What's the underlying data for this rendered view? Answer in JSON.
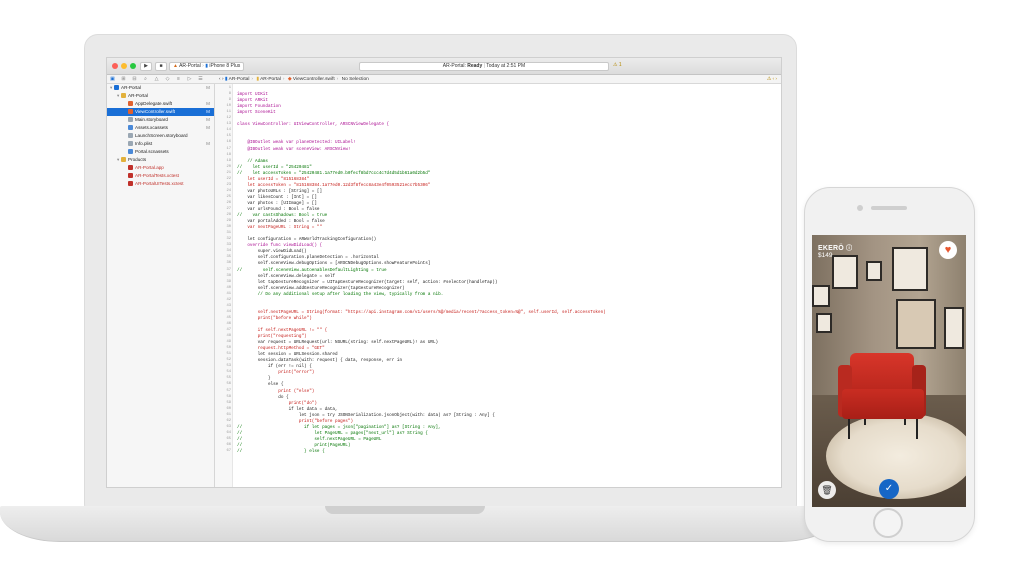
{
  "toolbar": {
    "scheme": "AR-Portal",
    "device": "iPhone 8 Plus",
    "status_app": "AR-Portal:",
    "status_state": "Ready",
    "status_time": "Today at 2:51 PM",
    "warning_count": "1"
  },
  "jumpbar": {
    "project": "AR-Portal",
    "folder": "AR-Portal",
    "file": "ViewController.swift",
    "selection": "No Selection"
  },
  "navigator": {
    "items": [
      {
        "label": "AR-Portal",
        "marker": "M",
        "indent": 0
      },
      {
        "label": "AR-Portal",
        "marker": "",
        "indent": 1
      },
      {
        "label": "AppDelegate.swift",
        "marker": "M",
        "indent": 2
      },
      {
        "label": "ViewController.swift",
        "marker": "M",
        "indent": 2
      },
      {
        "label": "Main.storyboard",
        "marker": "M",
        "indent": 2
      },
      {
        "label": "Assets.xcassets",
        "marker": "M",
        "indent": 2
      },
      {
        "label": "LaunchScreen.storyboard",
        "marker": "",
        "indent": 2
      },
      {
        "label": "Info.plist",
        "marker": "M",
        "indent": 2
      },
      {
        "label": "Portal.scnassets",
        "marker": "",
        "indent": 2
      },
      {
        "label": "Products",
        "marker": "",
        "indent": 1
      },
      {
        "label": "AR-Portal.app",
        "marker": "",
        "indent": 2
      },
      {
        "label": "AR-PortalTests.xctest",
        "marker": "",
        "indent": 2
      },
      {
        "label": "AR-PortalUITests.xctest",
        "marker": "",
        "indent": 2
      }
    ]
  },
  "code_lines": [
    {
      "n": "1",
      "t": ""
    },
    {
      "n": "8",
      "t": "import UIKit"
    },
    {
      "n": "9",
      "t": "import ARKit"
    },
    {
      "n": "10",
      "t": "import Foundation"
    },
    {
      "n": "11",
      "t": "import SceneKit"
    },
    {
      "n": "12",
      "t": ""
    },
    {
      "n": "13",
      "t": "class ViewController: UIViewController, ARSCNViewDelegate {"
    },
    {
      "n": "14",
      "t": ""
    },
    {
      "n": "15",
      "t": ""
    },
    {
      "n": "16",
      "t": "    @IBOutlet weak var planeDetected: UILabel!"
    },
    {
      "n": "17",
      "t": "    @IBOutlet weak var sceneView: ARSCNView!"
    },
    {
      "n": "18",
      "t": ""
    },
    {
      "n": "19",
      "t": "    // Adams"
    },
    {
      "n": "20",
      "t": "//    let userId = \"25420481\""
    },
    {
      "n": "21",
      "t": "//    let accessToken = \"25420481.1a77ed0.b0fecf8bd7ccc4c7d4d5d1b61a0d2b5d\""
    },
    {
      "n": "22",
      "t": "    let userId = \"815168384\""
    },
    {
      "n": "23",
      "t": "    let accessToken = \"815168384.1a77ed0.12d3f8fecc8a43e4f0593521ecc7b5306\""
    },
    {
      "n": "24",
      "t": "    var photoURLs : [String] = []"
    },
    {
      "n": "25",
      "t": "    var likesCount : [Int] = []"
    },
    {
      "n": "26",
      "t": "    var photos : [UIImage] = []"
    },
    {
      "n": "27",
      "t": "    var urlsFound : Bool = false"
    },
    {
      "n": "28",
      "t": "//    var castsShadows: Bool = true"
    },
    {
      "n": "29",
      "t": "    var portalAdded : Bool = false"
    },
    {
      "n": "30",
      "t": "    var nextPageURL : String = \"\""
    },
    {
      "n": "31",
      "t": ""
    },
    {
      "n": "32",
      "t": "    let configuration = ARWorldTrackingConfiguration()"
    },
    {
      "n": "33",
      "t": "    override func viewDidLoad() {"
    },
    {
      "n": "34",
      "t": "        super.viewDidLoad()"
    },
    {
      "n": "35",
      "t": "        self.configuration.planeDetection = .horizontal"
    },
    {
      "n": "36",
      "t": "        self.sceneView.debugOptions = [ARSCNDebugOptions.showFeaturePoints]"
    },
    {
      "n": "37",
      "t": "//        self.sceneView.autoenablesDefaultLighting = true"
    },
    {
      "n": "38",
      "t": "        self.sceneView.delegate = self"
    },
    {
      "n": "39",
      "t": "        let tapGestureRecognizer = UITapGestureRecognizer(target: self, action: #selector(handleTap))"
    },
    {
      "n": "40",
      "t": "        self.sceneView.addGestureRecognizer(tapGestureRecognizer)"
    },
    {
      "n": "41",
      "t": "        // Do any additional setup after loading the view, typically from a nib."
    },
    {
      "n": "42",
      "t": ""
    },
    {
      "n": "43",
      "t": ""
    },
    {
      "n": "44",
      "t": "        self.nextPageURL = String(format: \"https://api.instagram.com/v1/users/%@/media/recent/?access_token=%@\", self.userId, self.accessToken)"
    },
    {
      "n": "45",
      "t": "        print(\"before while\")"
    },
    {
      "n": "46",
      "t": ""
    },
    {
      "n": "47",
      "t": "        if self.nextPageURL != \"\" {"
    },
    {
      "n": "48",
      "t": "        print(\"requesting\")"
    },
    {
      "n": "49",
      "t": "        var request = URLRequest(url: NSURL(string: self.nextPageURL)! as URL)"
    },
    {
      "n": "50",
      "t": "        request.httpMethod = \"GET\""
    },
    {
      "n": "51",
      "t": "        let session = URLSession.shared"
    },
    {
      "n": "52",
      "t": "        session.dataTask(with: request) { data, response, err in"
    },
    {
      "n": "53",
      "t": "            if (err != nil) {"
    },
    {
      "n": "54",
      "t": "                print(\"error\")"
    },
    {
      "n": "55",
      "t": "            }"
    },
    {
      "n": "56",
      "t": "            else {"
    },
    {
      "n": "57",
      "t": "                print (\"else\")"
    },
    {
      "n": "58",
      "t": "                do {"
    },
    {
      "n": "59",
      "t": "                    print(\"do\")"
    },
    {
      "n": "60",
      "t": "                    if let data = data,"
    },
    {
      "n": "61",
      "t": "                        let json = try JSONSerialization.jsonObject(with: data) as? [String : Any] {"
    },
    {
      "n": "62",
      "t": "                        print(\"before pages\")"
    },
    {
      "n": "63",
      "t": "//                        if let pages = json[\"pagination\"] as? [String : Any],"
    },
    {
      "n": "64",
      "t": "//                            let PageURL = pages[\"next_url\"] as? String {"
    },
    {
      "n": "65",
      "t": "//                            self.nextPageURL = PageURL"
    },
    {
      "n": "66",
      "t": "//                            print(PageURL)"
    },
    {
      "n": "67",
      "t": "//                        } else {"
    }
  ],
  "phone": {
    "product_name": "EKERÖ",
    "product_price": "$149",
    "favorite_icon": "heart-icon",
    "delete_icon": "trash-icon",
    "confirm_icon": "check-icon"
  },
  "colors": {
    "selection": "#1a6fd6",
    "keyword": "#aa0d91",
    "string": "#c41a16",
    "comment": "#007400",
    "chair": "#c92d22",
    "confirm": "#1666c6"
  }
}
